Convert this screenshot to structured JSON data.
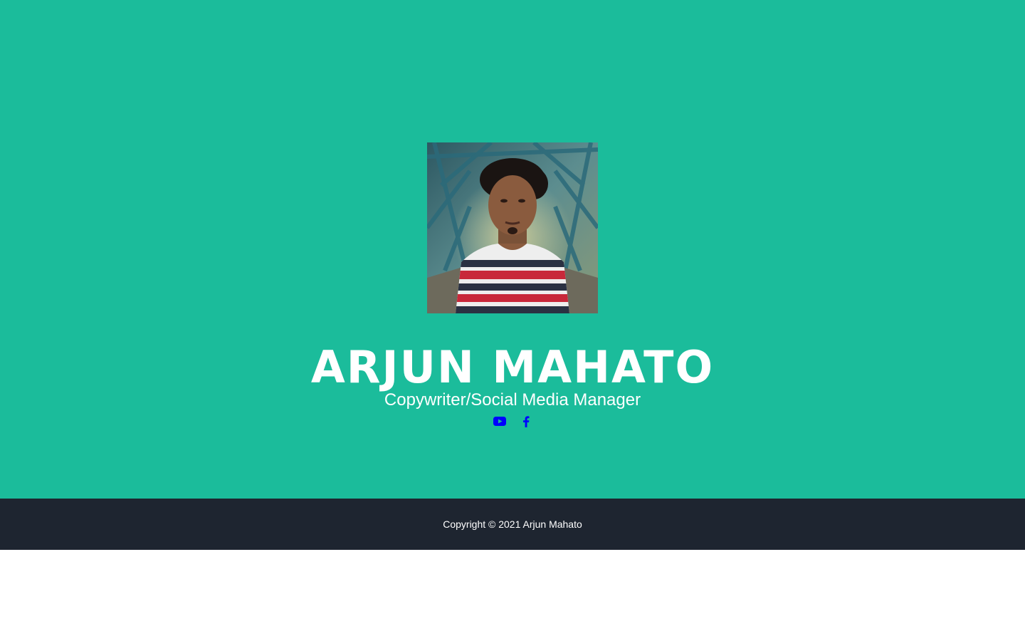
{
  "profile": {
    "name": "ARJUN MAHATO",
    "title": "Copywriter/Social Media Manager"
  },
  "social": {
    "links": [
      {
        "icon": "youtube-icon",
        "color": "#0000ff"
      },
      {
        "icon": "facebook-icon",
        "color": "#0000ff"
      }
    ]
  },
  "footer": {
    "copyright": "Copyright © 2021 Arjun Mahato"
  },
  "colors": {
    "hero_background": "#1bbc9b",
    "footer_background": "#1e2530",
    "text": "#ffffff",
    "link": "#0000ff"
  }
}
